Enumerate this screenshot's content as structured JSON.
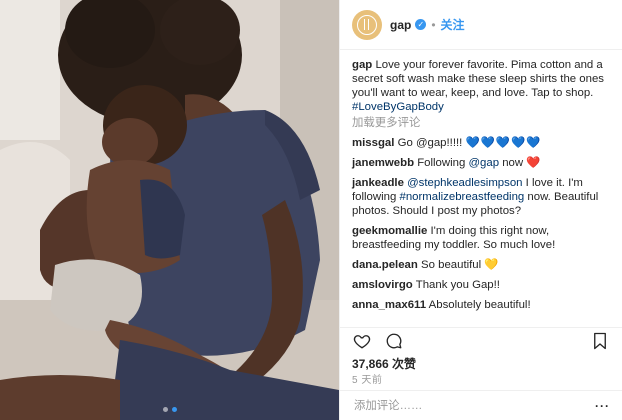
{
  "header": {
    "handle": "gap",
    "follow_label": "关注"
  },
  "caption": {
    "handle": "gap",
    "text": "Love your forever favorite. Pima cotton and a secret soft wash make these sleep shirts the ones you'll want to wear, keep, and love. Tap to shop.",
    "hashtag": "#LoveByGapBody"
  },
  "load_more_label": "加载更多评论",
  "comments": [
    {
      "user": "missgal",
      "mention": "Go @gap!!!!!",
      "text": "",
      "emoji": "💙💙💙💙💙"
    },
    {
      "user": "janemwebb",
      "mention": "",
      "text": "Following ",
      "link": "@gap",
      "text2": " now",
      "emoji": "❤️"
    },
    {
      "user": "jankeadle",
      "link": "@stephkeadlesimpson",
      "text": " I love it. I'm following ",
      "hashtag": "#normalizebreastfeeding",
      "text2": " now. Beautiful photos. Should I post my photos?"
    },
    {
      "user": "geekmomallie",
      "text": "I'm doing this right now, breastfeeding my toddler. So much love!"
    },
    {
      "user": "dana.pelean",
      "text": "So beautiful ",
      "emoji": "💛"
    },
    {
      "user": "amslovirgo",
      "text": "Thank you Gap!!"
    },
    {
      "user": "anna_max611",
      "text": "Absolutely beautiful!"
    }
  ],
  "likes": "37,866 次赞",
  "timestamp": "5 天前",
  "add_comment_placeholder": "添加评论……",
  "icons": {
    "like": "heart-outline-icon",
    "comment": "comment-bubble-icon",
    "bookmark": "bookmark-icon",
    "verified": "verified-badge-icon"
  },
  "colors": {
    "accent": "#3897f0",
    "link": "#003569",
    "muted": "#999999",
    "heart": "#ed4956"
  },
  "carousel": {
    "count": 2,
    "active": 1
  }
}
